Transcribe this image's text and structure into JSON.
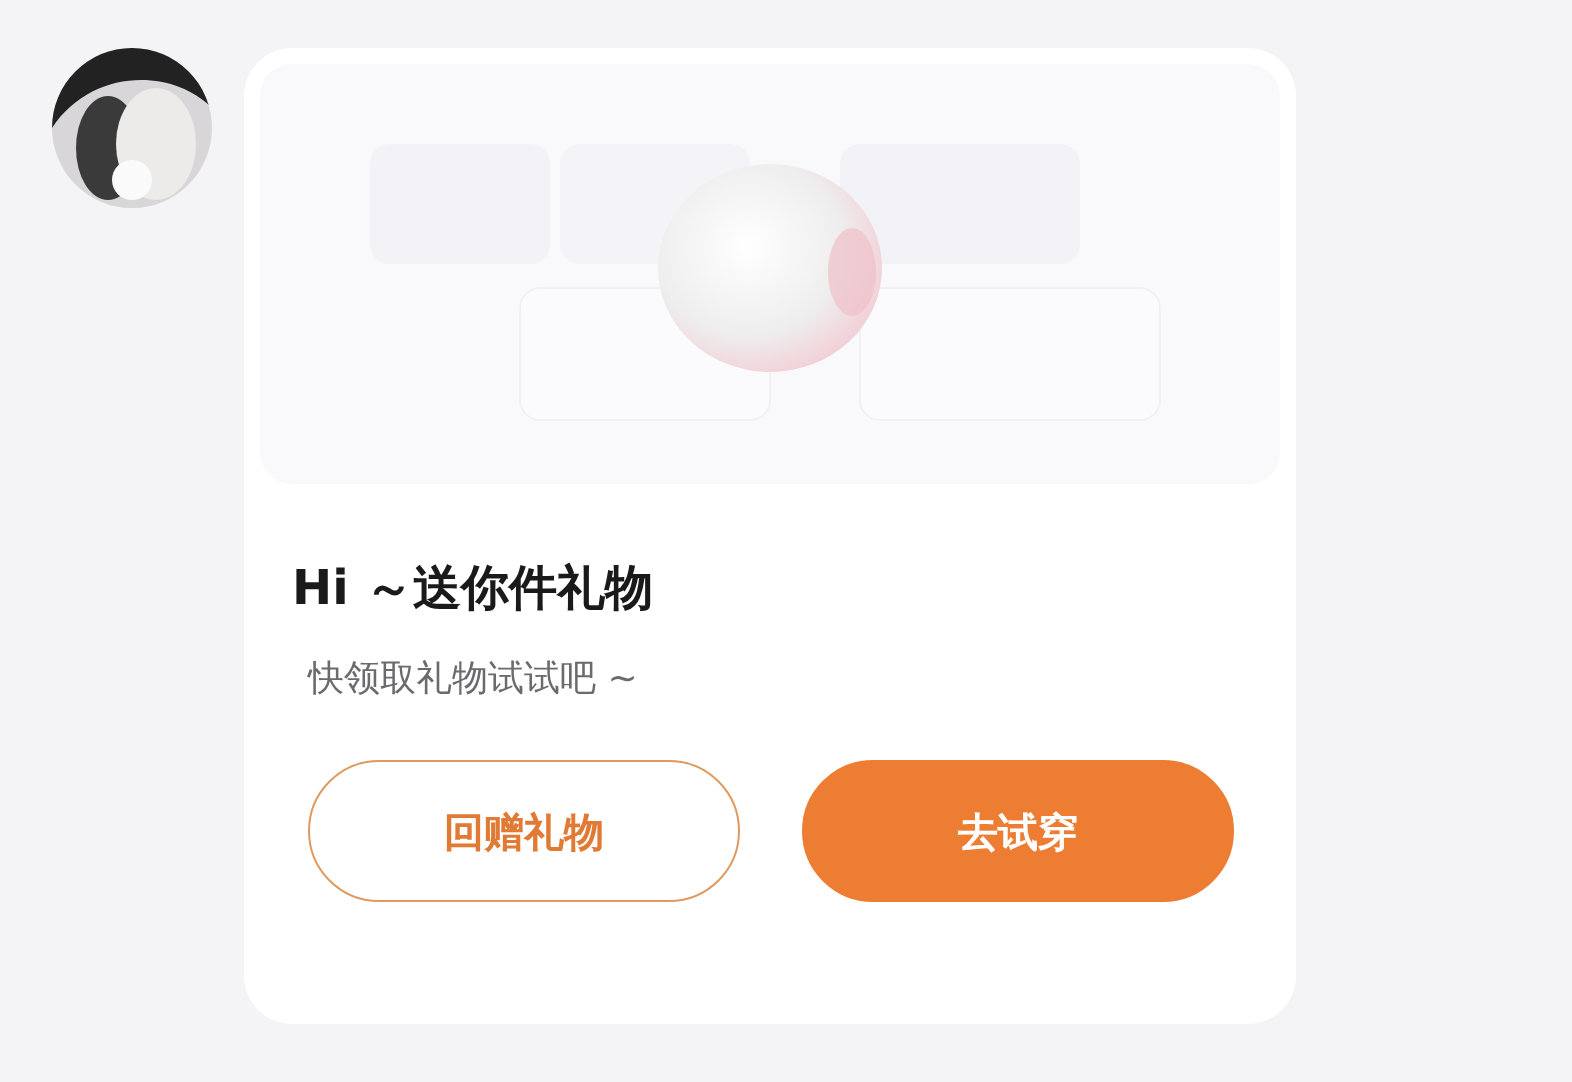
{
  "card": {
    "title": "Hi ～送你件礼物",
    "subtitle": "快领取礼物试试吧 ~",
    "buttons": [
      {
        "label": "回赠礼物",
        "kind": "outline"
      },
      {
        "label": "去试穿",
        "kind": "filled"
      }
    ]
  }
}
